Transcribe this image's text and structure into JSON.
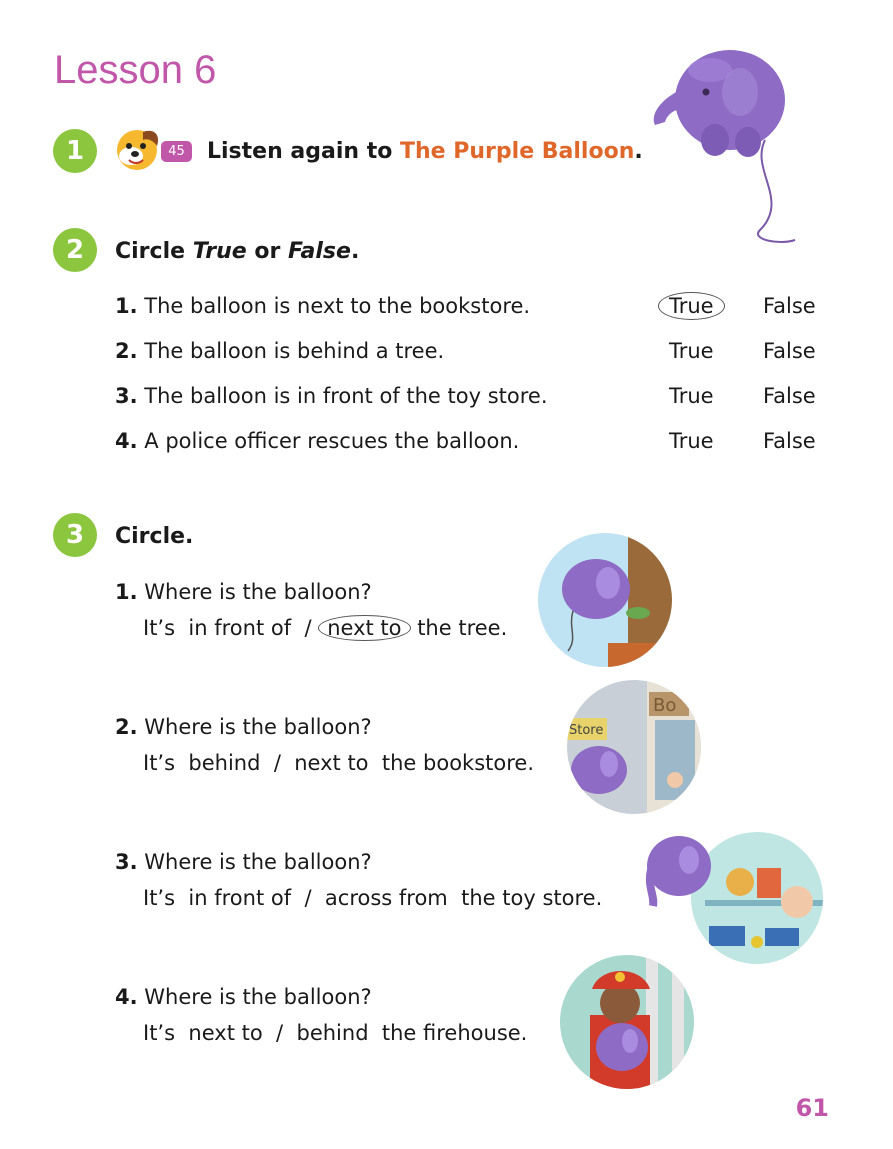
{
  "lesson_title": "Lesson 6",
  "exercise1": {
    "number": "1",
    "track": "45",
    "text_before": "Listen again to ",
    "story_title": "The Purple Balloon",
    "text_after": "."
  },
  "exercise2": {
    "number": "2",
    "title_parts": [
      "Circle ",
      "True",
      " or ",
      "False",
      "."
    ],
    "true_label": "True",
    "false_label": "False",
    "items": [
      {
        "n": "1.",
        "text": "The balloon is next to the bookstore."
      },
      {
        "n": "2.",
        "text": "The balloon is behind a tree."
      },
      {
        "n": "3.",
        "text": "The balloon is in front of the toy store."
      },
      {
        "n": "4.",
        "text": "A police officer rescues the balloon."
      }
    ]
  },
  "exercise3": {
    "number": "3",
    "title": "Circle.",
    "items": [
      {
        "n": "1.",
        "question": "Where is the balloon?",
        "prefix": "It’s",
        "opt1": "in front of",
        "sep": "/",
        "opt2": "next to",
        "place": "the tree."
      },
      {
        "n": "2.",
        "question": "Where is the balloon?",
        "prefix": "It’s",
        "opt1": "behind",
        "sep": "/",
        "opt2": "next to",
        "place": "the bookstore."
      },
      {
        "n": "3.",
        "question": "Where is the balloon?",
        "prefix": "It’s",
        "opt1": "in front of",
        "sep": "/",
        "opt2": "across from",
        "place": "the toy store."
      },
      {
        "n": "4.",
        "question": "Where is the balloon?",
        "prefix": "It’s",
        "opt1": "next to",
        "sep": "/",
        "opt2": "behind",
        "place": "the firehouse."
      }
    ]
  },
  "picture_labels": {
    "sign_store": "Store",
    "sign_bookstore": "Bo"
  },
  "page_number": "61",
  "colors": {
    "lesson_title": "#c057a9",
    "badge_green": "#8cc63f",
    "story_orange": "#e0672a",
    "balloon_purple": "#8e6bc4"
  }
}
